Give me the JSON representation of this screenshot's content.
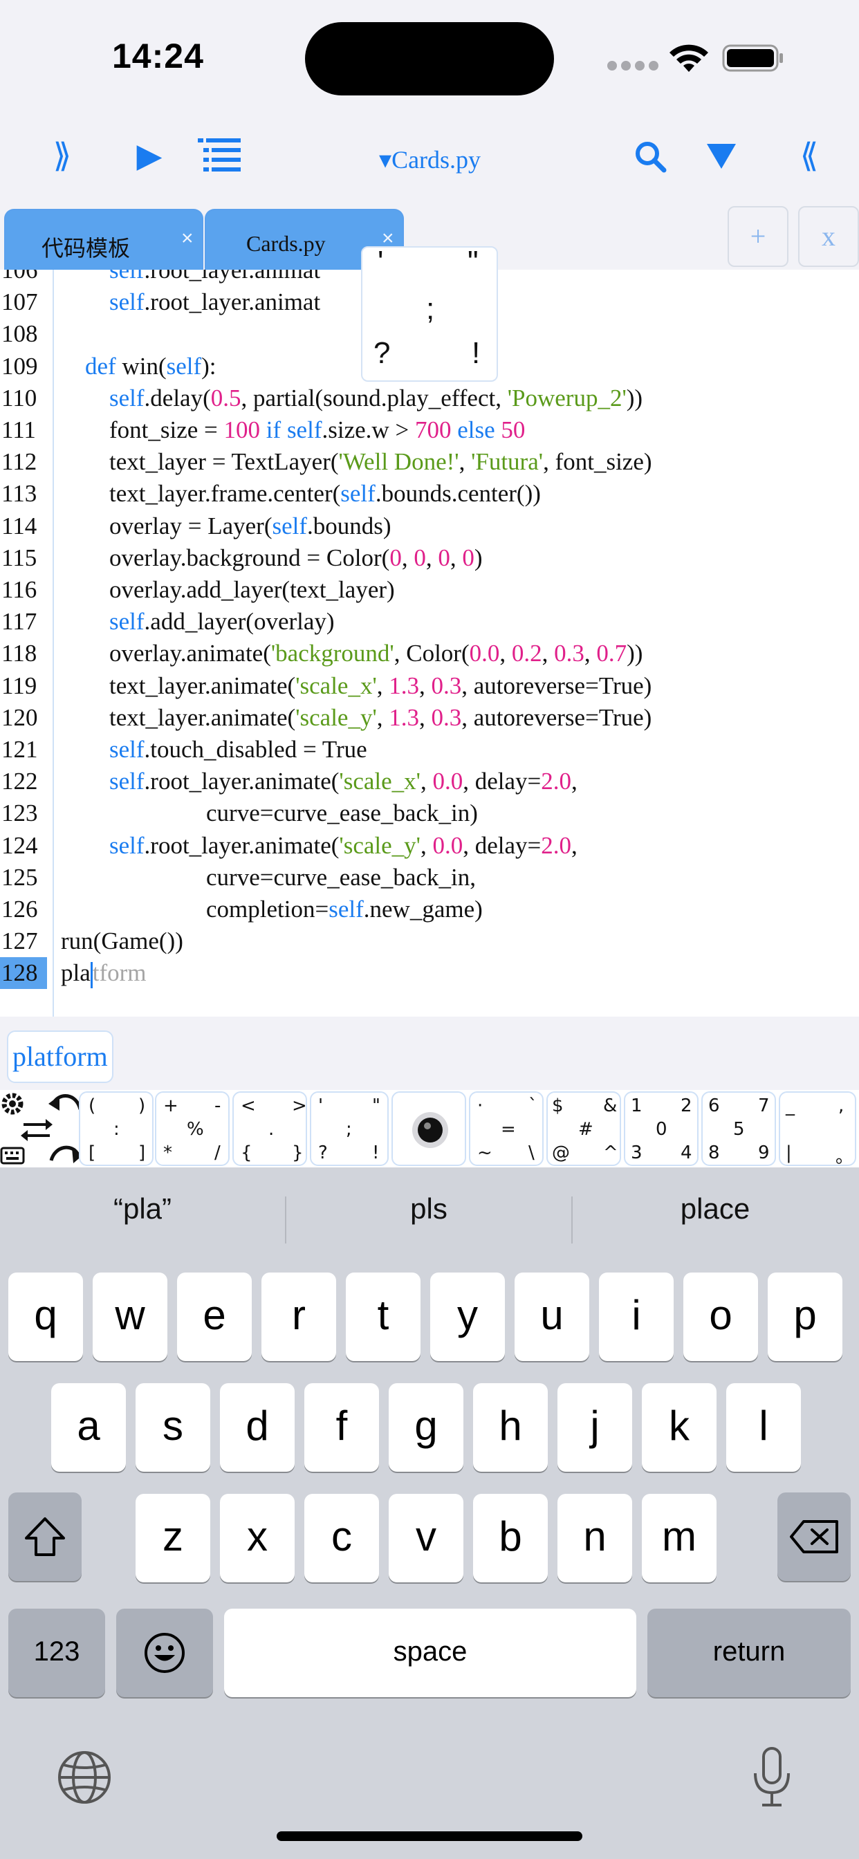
{
  "status_bar": {
    "time": "14:24"
  },
  "toolbar": {
    "left_expand": "⟫",
    "run": "▶",
    "outline": "≣",
    "file_title": "▾Cards.py",
    "search": "⌕",
    "menu": "▼",
    "right_collapse": "⟪"
  },
  "tabs": [
    {
      "label": "代码模板",
      "close": "×"
    },
    {
      "label": "Cards.py",
      "close": "×"
    }
  ],
  "tab_controls": {
    "add": "+",
    "close_all": "x"
  },
  "punct_popup": {
    "keys": [
      "'",
      "\"",
      ";",
      "?",
      "!"
    ]
  },
  "editor": {
    "lines": [
      {
        "n": "106",
        "text": "        self.root_layer.animat                    .0)"
      },
      {
        "n": "107",
        "text": "        self.root_layer.animat                    .0)"
      },
      {
        "n": "108",
        "text": ""
      },
      {
        "n": "109",
        "text": "    def win(self):"
      },
      {
        "n": "110",
        "text": "        self.delay(0.5, partial(sound.play_effect, 'Powerup_2'))"
      },
      {
        "n": "111",
        "text": "        font_size = 100 if self.size.w > 700 else 50"
      },
      {
        "n": "112",
        "text": "        text_layer = TextLayer('Well Done!', 'Futura', font_size)"
      },
      {
        "n": "113",
        "text": "        text_layer.frame.center(self.bounds.center())"
      },
      {
        "n": "114",
        "text": "        overlay = Layer(self.bounds)"
      },
      {
        "n": "115",
        "text": "        overlay.background = Color(0, 0, 0, 0)"
      },
      {
        "n": "116",
        "text": "        overlay.add_layer(text_layer)"
      },
      {
        "n": "117",
        "text": "        self.add_layer(overlay)"
      },
      {
        "n": "118",
        "text": "        overlay.animate('background', Color(0.0, 0.2, 0.3, 0.7))"
      },
      {
        "n": "119",
        "text": "        text_layer.animate('scale_x', 1.3, 0.3, autoreverse=True)"
      },
      {
        "n": "120",
        "text": "        text_layer.animate('scale_y', 1.3, 0.3, autoreverse=True)"
      },
      {
        "n": "121",
        "text": "        self.touch_disabled = True"
      },
      {
        "n": "122",
        "text": "        self.root_layer.animate('scale_x', 0.0, delay=2.0,"
      },
      {
        "n": "123",
        "text": "                        curve=curve_ease_back_in)"
      },
      {
        "n": "124",
        "text": "        self.root_layer.animate('scale_y', 0.0, delay=2.0,"
      },
      {
        "n": "125",
        "text": "                        curve=curve_ease_back_in,"
      },
      {
        "n": "126",
        "text": "                        completion=self.new_game)"
      },
      {
        "n": "127",
        "text": "run(Game())"
      },
      {
        "n": "128",
        "typed": "pla",
        "ghost": "tform"
      }
    ]
  },
  "autocomplete": {
    "suggestion": "platform"
  },
  "accessory_keys": [
    {
      "chars": [
        "(",
        ")",
        ":",
        "[",
        "]"
      ]
    },
    {
      "chars": [
        "+",
        "-",
        "%",
        "*",
        "/"
      ]
    },
    {
      "chars": [
        "<",
        ">",
        ".",
        "{",
        "}"
      ]
    },
    {
      "chars": [
        "'",
        "\"",
        ";",
        "?",
        "!"
      ]
    },
    {
      "chars": [
        "·",
        "`",
        "=",
        "~",
        "\\"
      ]
    },
    {
      "chars": [
        "$",
        "&",
        "#",
        "@",
        "^"
      ]
    },
    {
      "chars": [
        "1",
        "2",
        "0",
        "3",
        "4"
      ]
    },
    {
      "chars": [
        "6",
        "7",
        "5",
        "8",
        "9"
      ]
    },
    {
      "chars": [
        "_",
        ",",
        "|",
        "。"
      ]
    }
  ],
  "keyboard": {
    "predictions": [
      "“pla”",
      "pls",
      "place"
    ],
    "row1": [
      "q",
      "w",
      "e",
      "r",
      "t",
      "y",
      "u",
      "i",
      "o",
      "p"
    ],
    "row2": [
      "a",
      "s",
      "d",
      "f",
      "g",
      "h",
      "j",
      "k",
      "l"
    ],
    "row3": [
      "z",
      "x",
      "c",
      "v",
      "b",
      "n",
      "m"
    ],
    "numbers_key": "123",
    "space_key": "space",
    "return_key": "return"
  },
  "colors": {
    "accent": "#1a7cf0",
    "number": "#e0208a",
    "string": "#5a9a1a",
    "tab_active": "#5aa3ee",
    "keyboard_bg": "#d1d4db"
  }
}
